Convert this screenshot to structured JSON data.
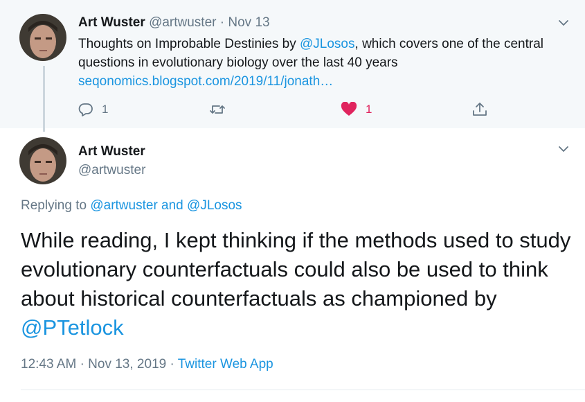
{
  "parent_tweet": {
    "author_name": "Art Wuster",
    "author_handle": "@artwuster",
    "separator": "·",
    "date": "Nov 13",
    "text_before_mention": "Thoughts on Improbable Destinies by ",
    "mention": "@JLosos",
    "text_after_mention": ", which covers one of the central questions in evolutionary biology over the last 40 years",
    "link": "seqonomics.blogspot.com/2019/11/jonath…",
    "reply_count": "1",
    "like_count": "1"
  },
  "main_tweet": {
    "author_name": "Art Wuster",
    "author_handle": "@artwuster",
    "replying_prefix": "Replying to ",
    "replying_user1": "@artwuster",
    "replying_and": " and ",
    "replying_user2": "@JLosos",
    "text": "While reading, I kept thinking if the methods used to study evolutionary counterfactuals could also be used to think about historical counterfactuals as championed by ",
    "mention": "@PTetlock",
    "time": "12:43 AM",
    "separator": "·",
    "date": "Nov 13, 2019",
    "source": "Twitter Web App"
  },
  "colors": {
    "link": "#1b95e0",
    "like": "#e0245e",
    "secondary": "#657786",
    "parent_bg": "#f5f8fa"
  },
  "icons": [
    "reply-icon",
    "retweet-icon",
    "heart-icon",
    "share-icon",
    "chevron-down-icon"
  ]
}
